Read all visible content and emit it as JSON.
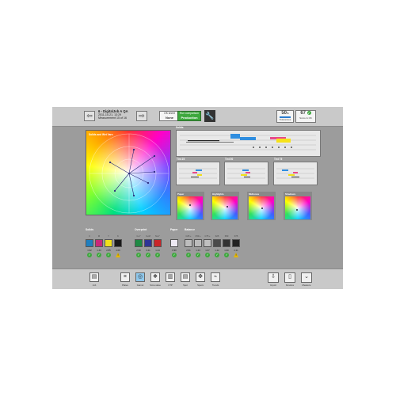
{
  "header": {
    "job_title": "6 - DigitalJob A QA",
    "job_date": "2011-10-21, 13:29",
    "job_meas": "Measurement 15 of 16",
    "ok_label": "OK sheet",
    "ok_value": "None",
    "mode_label": "Run comparison",
    "mode_value": "Production",
    "tol_value": "50",
    "tol_unit": "%",
    "tol_label": "Tolerances",
    "score_value": "67",
    "score_label": "Score & OK",
    "check_glyph": "✓"
  },
  "gamut": {
    "title": "Solids and Wet Varn",
    "point_labels": [
      "",
      "",
      "",
      "",
      "",
      "",
      ""
    ]
  },
  "panels": {
    "solids_title": "Solids",
    "tint_titles": [
      "Tint 25",
      "Tint 50",
      "Tint 75"
    ],
    "swatch_titles": [
      "Paper",
      "Highlights",
      "Midtones",
      "Shadows"
    ]
  },
  "patches": {
    "solids_label": "Solids",
    "overprint_label": "Overprint",
    "paper_label": "Paper",
    "balance_label": "Balance",
    "solids_tops": [
      "C",
      "M",
      "Y",
      "K"
    ],
    "solids_values": [
      "1.92",
      "1.43",
      "2.85",
      "4.06"
    ],
    "over_tops": [
      "C+Y",
      "C+M",
      "M+Y"
    ],
    "over_values": [
      "2.90",
      "3.21",
      "1.24"
    ],
    "paper_value": "0.90",
    "balance_tops": [
      "C25 +",
      "C50 +",
      "C75 +",
      "K25",
      "K50",
      "K75"
    ],
    "balance_values": [
      "2.61",
      "1.23",
      "1.07",
      "1.22",
      "1.90",
      "4.21"
    ],
    "solid_colors": [
      "#1f7fbf",
      "#c8287a",
      "#f1e01a",
      "#1a1a1a"
    ],
    "over_colors": [
      "#1e8a44",
      "#2e3596",
      "#c8262a"
    ],
    "paper_color": "#ede9f2",
    "balance_colors": [
      "#bdbdbd",
      "#bcbcbc",
      "#c0c0c0",
      "#4b4b4b",
      "#323232",
      "#222222"
    ]
  },
  "bottom": {
    "job_label": "Job",
    "tools": [
      "Plates",
      "Gamut",
      "Scna value",
      "CTP",
      "Spot",
      "Specs",
      "Trends"
    ],
    "right_tools": [
      "Import",
      "Devices",
      "Measure"
    ]
  }
}
